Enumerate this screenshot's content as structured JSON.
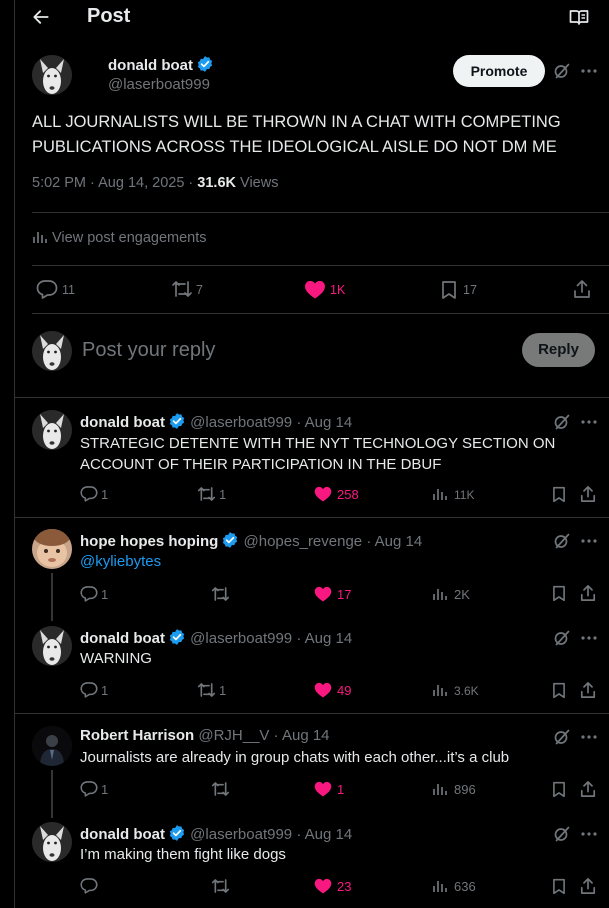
{
  "header": {
    "title": "Post"
  },
  "main_post": {
    "author_name": "donald boat",
    "author_handle": "@laserboat999",
    "promote_label": "Promote",
    "text": "ALL JOURNALISTS WILL BE THROWN IN A CHAT WITH COMPETING PUBLICATIONS ACROSS THE IDEOLOGICAL AISLE DO NOT DM ME",
    "time": "5:02 PM",
    "date": "Aug 14, 2025",
    "views_count": "31.6K",
    "views_label": "Views",
    "engagements_label": "View post engagements",
    "replies": "11",
    "reposts": "7",
    "likes": "1K",
    "bookmarks": "17"
  },
  "reply_box": {
    "placeholder": "Post your reply",
    "button_label": "Reply"
  },
  "replies": [
    {
      "name": "donald boat",
      "handle": "@laserboat999",
      "date": "Aug 14",
      "text": "STRATEGIC DETENTE WITH THE NYT TECHNOLOGY SECTION ON ACCOUNT OF THEIR PARTICIPATION IN THE DBUF",
      "replies": "1",
      "reposts": "1",
      "likes": "258",
      "views": "11K"
    },
    {
      "name": "hope hopes hoping",
      "handle": "@hopes_revenge",
      "date": "Aug 14",
      "text": "@kyliebytes",
      "replies": "1",
      "reposts": "",
      "likes": "17",
      "views": "2K"
    },
    {
      "name": "donald boat",
      "handle": "@laserboat999",
      "date": "Aug 14",
      "text": "WARNING",
      "replies": "1",
      "reposts": "1",
      "likes": "49",
      "views": "3.6K"
    },
    {
      "name": "Robert Harrison",
      "handle": "@RJH__V",
      "date": "Aug 14",
      "text": "Journalists are already in group chats with each other...it’s a club",
      "replies": "1",
      "reposts": "",
      "likes": "1",
      "views": "896"
    },
    {
      "name": "donald boat",
      "handle": "@laserboat999",
      "date": "Aug 14",
      "text": "I’m making them fight like dogs",
      "replies": "",
      "reposts": "",
      "likes": "23",
      "views": "636"
    }
  ],
  "separator": "·",
  "colors": {
    "background": "#000000",
    "text": "#e7e9ea",
    "muted": "#71767b",
    "link": "#1d9bf0",
    "like": "#f91880",
    "verified": "#1d9bf0",
    "border": "#2f3336"
  },
  "icons": [
    "back-arrow-icon",
    "reader-icon",
    "verified-icon",
    "grok-icon",
    "more-icon",
    "reply-icon",
    "repost-icon",
    "like-icon",
    "bookmark-icon",
    "share-icon",
    "analytics-icon"
  ]
}
